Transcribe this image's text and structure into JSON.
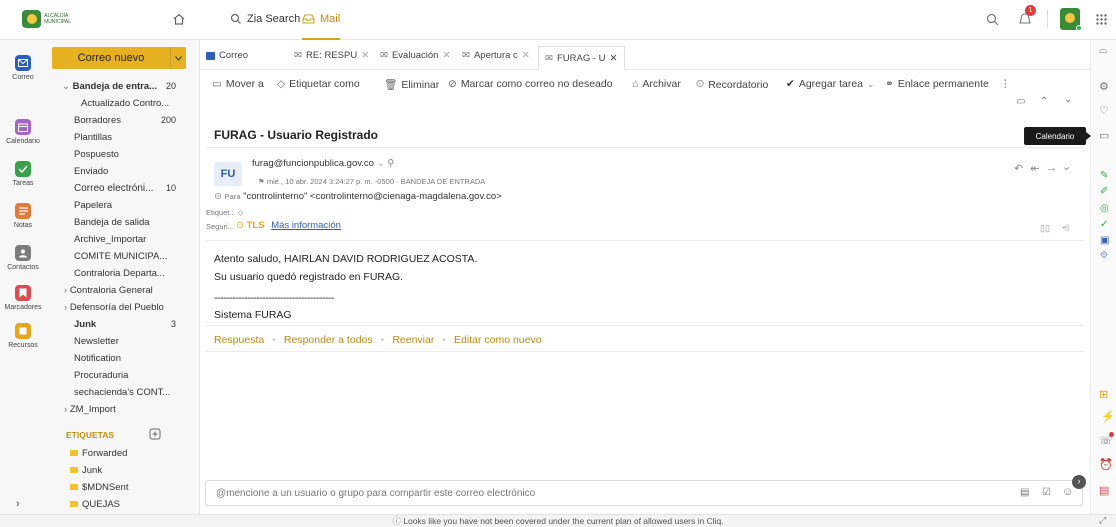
{
  "topbar": {
    "logo_text": "ALCALDÍA MUNICIPAL",
    "zia_search": "Zia Search",
    "mail": "Mail",
    "notif_count": "1"
  },
  "compose": {
    "new_mail": "Correo nuevo"
  },
  "rail": [
    {
      "label": "Correo",
      "color": "#2e5fb8"
    },
    {
      "label": "Calendario",
      "color": "#a466c6"
    },
    {
      "label": "Tareas",
      "color": "#3aa049"
    },
    {
      "label": "Notas",
      "color": "#e07a3a"
    },
    {
      "label": "Contactos",
      "color": "#7c7c7c"
    },
    {
      "label": "Marcadores",
      "color": "#d94c53"
    },
    {
      "label": "Recursos",
      "color": "#e5a51d"
    }
  ],
  "folders": {
    "inbox": "Bandeja de entra...",
    "inbox_count": "20",
    "updated": "Actualizado Contro...",
    "drafts": "Borradores",
    "drafts_count": "200",
    "templates": "Plantillas",
    "snoozed": "Pospuesto",
    "sent": "Enviado",
    "email": "Correo electróni...",
    "email_count": "10",
    "trash": "Papelera",
    "outbox": "Bandeja de salida",
    "archive_import": "Archive_Importar",
    "comite": "COMITE MUNICIPA...",
    "contraloria_dep": "Contraloria Departa...",
    "contraloria_gen": "Contraloria General",
    "defensoria": "Defensoría del Pueblo",
    "junk": "Junk",
    "junk_count": "3",
    "newsletter": "Newsletter",
    "notification": "Notification",
    "procuraduria": "Procuraduria",
    "sechacienda": "sechacienda's CONT...",
    "zm_import": "ZM_Import",
    "tags_header": "ETIQUETAS",
    "tags": [
      {
        "label": "Forwarded",
        "color": "#f2c230"
      },
      {
        "label": "Junk",
        "color": "#f2c230"
      },
      {
        "label": "$MDNSent",
        "color": "#f2c230"
      },
      {
        "label": "QUEJAS",
        "color": "#f2c230"
      }
    ]
  },
  "tabs": [
    {
      "label": "Correo"
    },
    {
      "label": "RE: RESPU"
    },
    {
      "label": "Evaluación"
    },
    {
      "label": "Apertura c"
    },
    {
      "label": "FURAG - U"
    }
  ],
  "toolbar": {
    "move": "Mover a",
    "tag": "Etiquetar como",
    "delete": "Eliminar",
    "spam": "Marcar como correo no deseado",
    "archive": "Archivar",
    "reminder": "Recordatorio",
    "task": "Agregar tarea",
    "permalink": "Enlace permanente"
  },
  "email": {
    "subject": "FURAG - Usuario Registrado",
    "avatar": "FU",
    "from": "furag@funcionpublica.gov.co",
    "date": "mié., 10 abr. 2024 3:24:27 p. m. -0500",
    "folder": "BANDEJA DE ENTRADA",
    "to_label": "Para",
    "to": "\"controlinterno\" <controlinterno@cienaga-magdalena.gov.co>",
    "tags_label": "Etiquet...",
    "security_label": "Seguri...",
    "tls": "TLS",
    "more_info": "Más información",
    "greeting": "Atento saludo, HAIRLAN DAVID RODRIGUEZ ACOSTA.",
    "line1": "Su usuario quedó registrado en FURAG.",
    "divider": "----------------------------------------",
    "signature": "Sistema FURAG"
  },
  "actions": {
    "reply": "Respuesta",
    "reply_all": "Responder a todos",
    "forward": "Reenviar",
    "edit_new": "Editar como nuevo"
  },
  "comment_placeholder": "@mencione a un usuario o grupo para compartir este correo electrónico",
  "tooltip": "Calendario",
  "status": "Looks like you have not been covered under the current plan of allowed users in Cliq."
}
